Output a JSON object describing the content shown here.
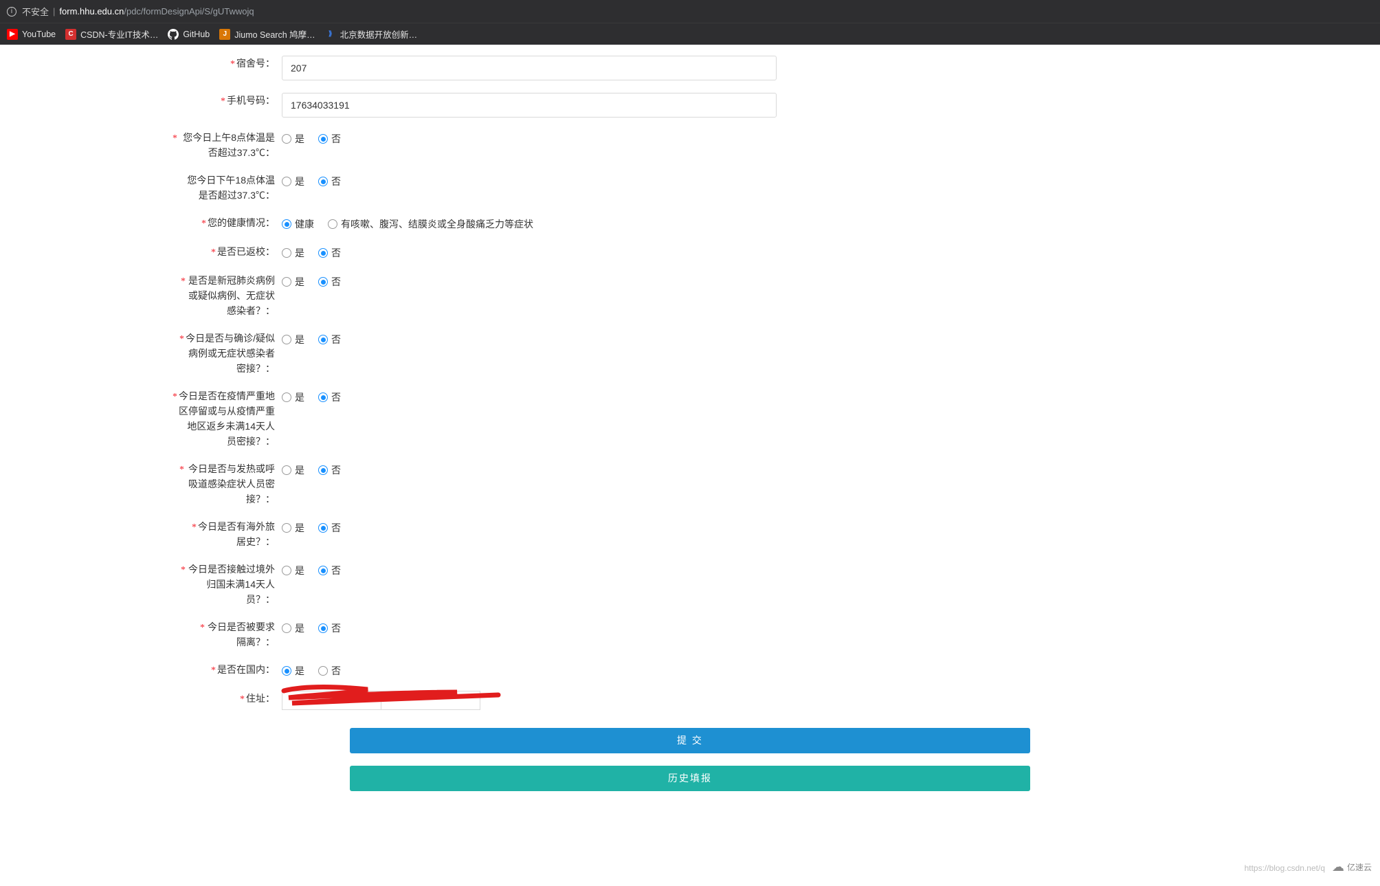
{
  "browser": {
    "security_label": "不安全",
    "url_host": "form.hhu.edu.cn",
    "url_path": "/pdc/formDesignApi/S/gUTwwojq"
  },
  "bookmarks": {
    "youtube": "YouTube",
    "csdn": "CSDN-专业IT技术…",
    "github": "GitHub",
    "jiumo": "Jiumo Search 鸠摩…",
    "beijing": "北京数据开放创新…"
  },
  "form": {
    "dorm_label": "宿舍号：",
    "dorm_value": "207",
    "phone_label": "手机号码：",
    "phone_value": "17634033191",
    "temp_am_label": "您今日上午8点体温是否超过37.3℃：",
    "temp_pm_label": "您今日下午18点体温是否超过37.3℃：",
    "health_label": "您的健康情况：",
    "return_label": "是否已返校：",
    "covid_case_label": "是否是新冠肺炎病例或疑似病例、无症状感染者？：",
    "contact_confirmed_label": "今日是否与确诊/疑似病例或无症状感染者密接？：",
    "epidemic_area_label": "今日是否在疫情严重地区停留或与从疫情严重地区返乡未满14天人员密接？：",
    "fever_contact_label": "今日是否与发热或呼吸道感染症状人员密接？：",
    "overseas_label": "今日是否有海外旅居史？：",
    "overseas_return_label": "今日是否接触过境外归国未满14天人员？：",
    "quarantine_label": "今日是否被要求隔离？：",
    "in_china_label": "是否在国内：",
    "address_label": "住址：",
    "yes": "是",
    "no": "否",
    "healthy": "健康",
    "symptoms": "有咳嗽、腹泻、结膜炎或全身酸痛乏力等症状"
  },
  "buttons": {
    "submit": "提 交",
    "history": "历史填报"
  },
  "footer": {
    "watermark": "https://blog.csdn.net/q",
    "brand": "亿速云"
  }
}
